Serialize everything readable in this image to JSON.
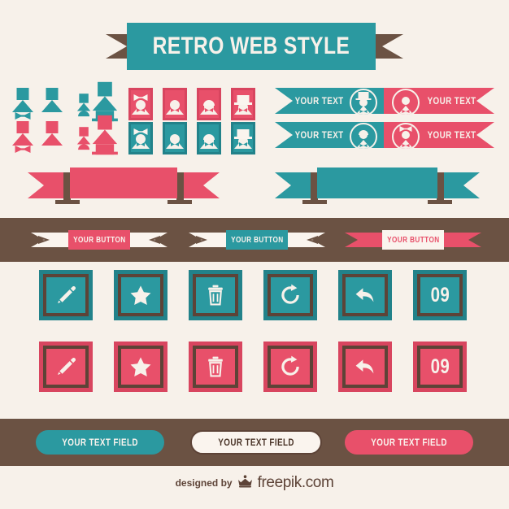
{
  "palette": {
    "background": "#f7f1ea",
    "cream": "#faf4ee",
    "teal": "#2b99a0",
    "teal_dark": "#22828a",
    "red": "#e8506a",
    "red_dark": "#d8455f",
    "brown": "#6b5243",
    "brown_dark": "#5d4337"
  },
  "title": {
    "text": "RETRO WEB STYLE"
  },
  "avatars": {
    "mini_rows": [
      {
        "color": "teal",
        "items": [
          "girl",
          "person",
          "kid",
          "hat-man"
        ]
      },
      {
        "color": "red",
        "items": [
          "girl",
          "person",
          "kid",
          "hat-man"
        ]
      }
    ],
    "badge_rows": [
      {
        "color": "red",
        "items": [
          "girl",
          "person",
          "kid",
          "hat-man"
        ]
      },
      {
        "color": "teal",
        "items": [
          "girl",
          "person",
          "kid",
          "hat-man"
        ]
      }
    ]
  },
  "text_ribbons": [
    {
      "label": "YOUR TEXT",
      "color": "teal",
      "avatar": "hat-man",
      "medal_side": "right",
      "tail_side": "left"
    },
    {
      "label": "YOUR TEXT",
      "color": "red",
      "avatar": "person",
      "medal_side": "left",
      "tail_side": "right"
    },
    {
      "label": "YOUR TEXT",
      "color": "teal",
      "avatar": "kid",
      "medal_side": "right",
      "tail_side": "left"
    },
    {
      "label": "YOUR TEXT",
      "color": "red",
      "avatar": "girl",
      "medal_side": "left",
      "tail_side": "right"
    }
  ],
  "big_banners": [
    {
      "color": "red",
      "label": ""
    },
    {
      "color": "teal",
      "label": ""
    }
  ],
  "buttons": [
    {
      "label": "YOUR BUTTON",
      "style": "red-fill"
    },
    {
      "label": "YOUR BUTTON",
      "style": "teal-fill"
    },
    {
      "label": "YOUR BUTTON",
      "style": "cream-fill"
    }
  ],
  "icon_buttons": {
    "row_teal": [
      {
        "icon": "pencil-icon",
        "label": ""
      },
      {
        "icon": "star-icon",
        "label": ""
      },
      {
        "icon": "trash-icon",
        "label": ""
      },
      {
        "icon": "refresh-icon",
        "label": ""
      },
      {
        "icon": "reply-icon",
        "label": ""
      },
      {
        "icon": "counter",
        "label": "09"
      }
    ],
    "row_red": [
      {
        "icon": "pencil-icon",
        "label": ""
      },
      {
        "icon": "star-icon",
        "label": ""
      },
      {
        "icon": "trash-icon",
        "label": ""
      },
      {
        "icon": "refresh-icon",
        "label": ""
      },
      {
        "icon": "reply-icon",
        "label": ""
      },
      {
        "icon": "counter",
        "label": "09"
      }
    ]
  },
  "text_fields": [
    {
      "label": "YOUR TEXT FIELD",
      "style": "teal"
    },
    {
      "label": "YOUR TEXT FIELD",
      "style": "cream"
    },
    {
      "label": "YOUR TEXT FIELD",
      "style": "red"
    }
  ],
  "footer": {
    "designed_by": "designed by",
    "brand": "freepik.com",
    "logo": "crown-icon"
  }
}
